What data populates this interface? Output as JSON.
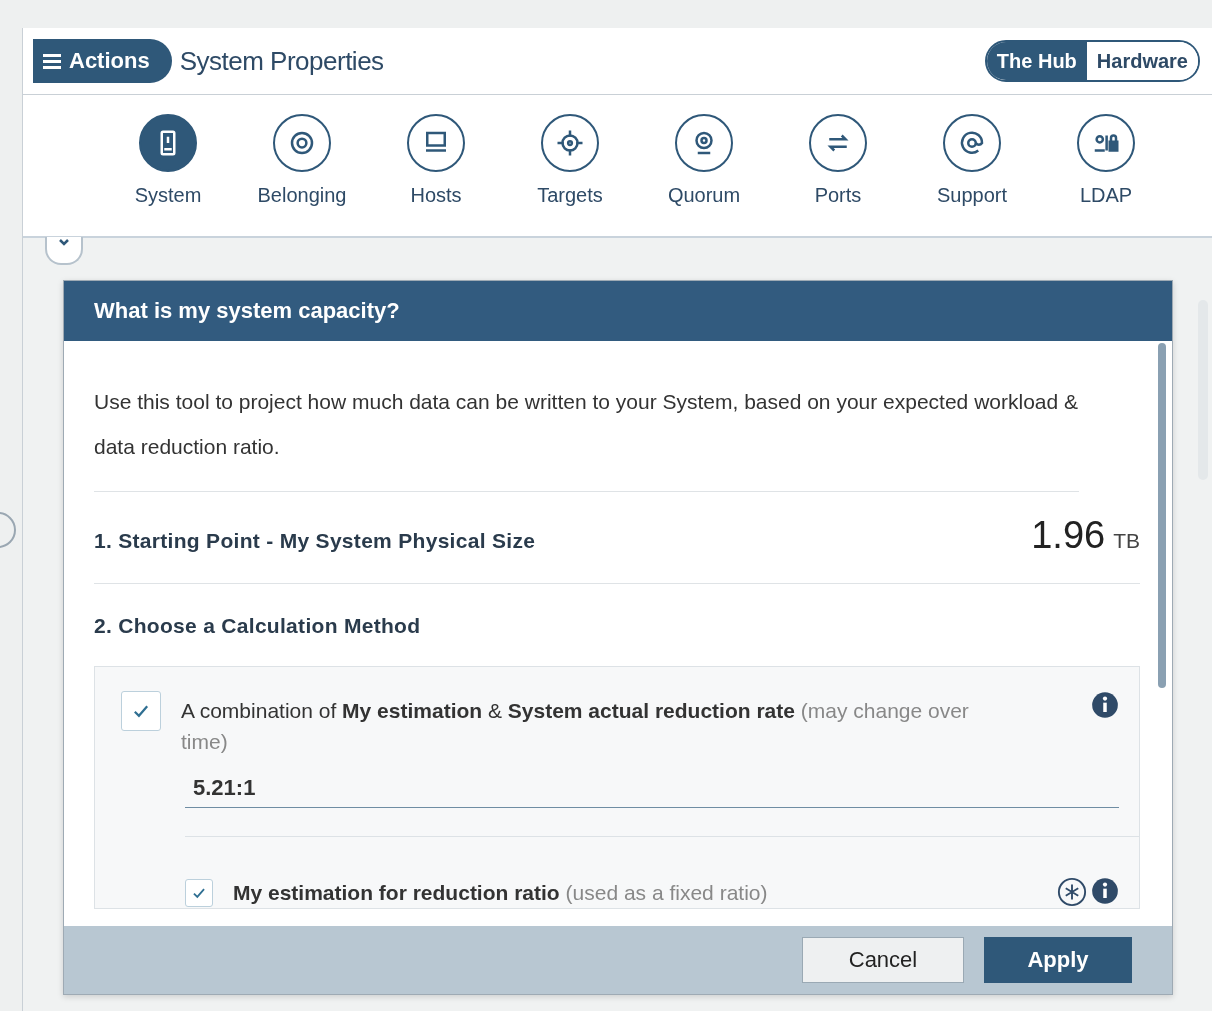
{
  "header": {
    "actions_button": "Actions",
    "title": "System Properties",
    "toggle": [
      {
        "label": "The Hub",
        "selected": true
      },
      {
        "label": "Hardware",
        "selected": false
      }
    ]
  },
  "nav": [
    {
      "label": "System",
      "selected": true
    },
    {
      "label": "Belonging",
      "selected": false
    },
    {
      "label": "Hosts",
      "selected": false
    },
    {
      "label": "Targets",
      "selected": false
    },
    {
      "label": "Quorum",
      "selected": false
    },
    {
      "label": "Ports",
      "selected": false
    },
    {
      "label": "Support",
      "selected": false
    },
    {
      "label": "LDAP",
      "selected": false
    }
  ],
  "modal": {
    "title": "What is my system capacity?",
    "intro": "Use this tool to project how much data can be written to your System, based on your expected workload & data reduction ratio.",
    "starting_point": {
      "label": "1. Starting Point - My System Physical Size",
      "value": "1.96",
      "unit": "TB"
    },
    "method_heading": "2. Choose a Calculation Method",
    "options": [
      {
        "kind": "combined",
        "checked": true,
        "label": "A combination of **My estimation** & **System actual reduction rate**",
        "note": "(may change over time)",
        "value": "5.21:1"
      },
      {
        "kind": "fixed",
        "checked": true,
        "label": "**My estimation for reduction ratio**",
        "note": "(used as a fixed ratio)"
      }
    ],
    "buttons": [
      {
        "label": "Cancel",
        "kind": "secondary"
      },
      {
        "label": "Apply",
        "kind": "primary"
      }
    ]
  }
}
